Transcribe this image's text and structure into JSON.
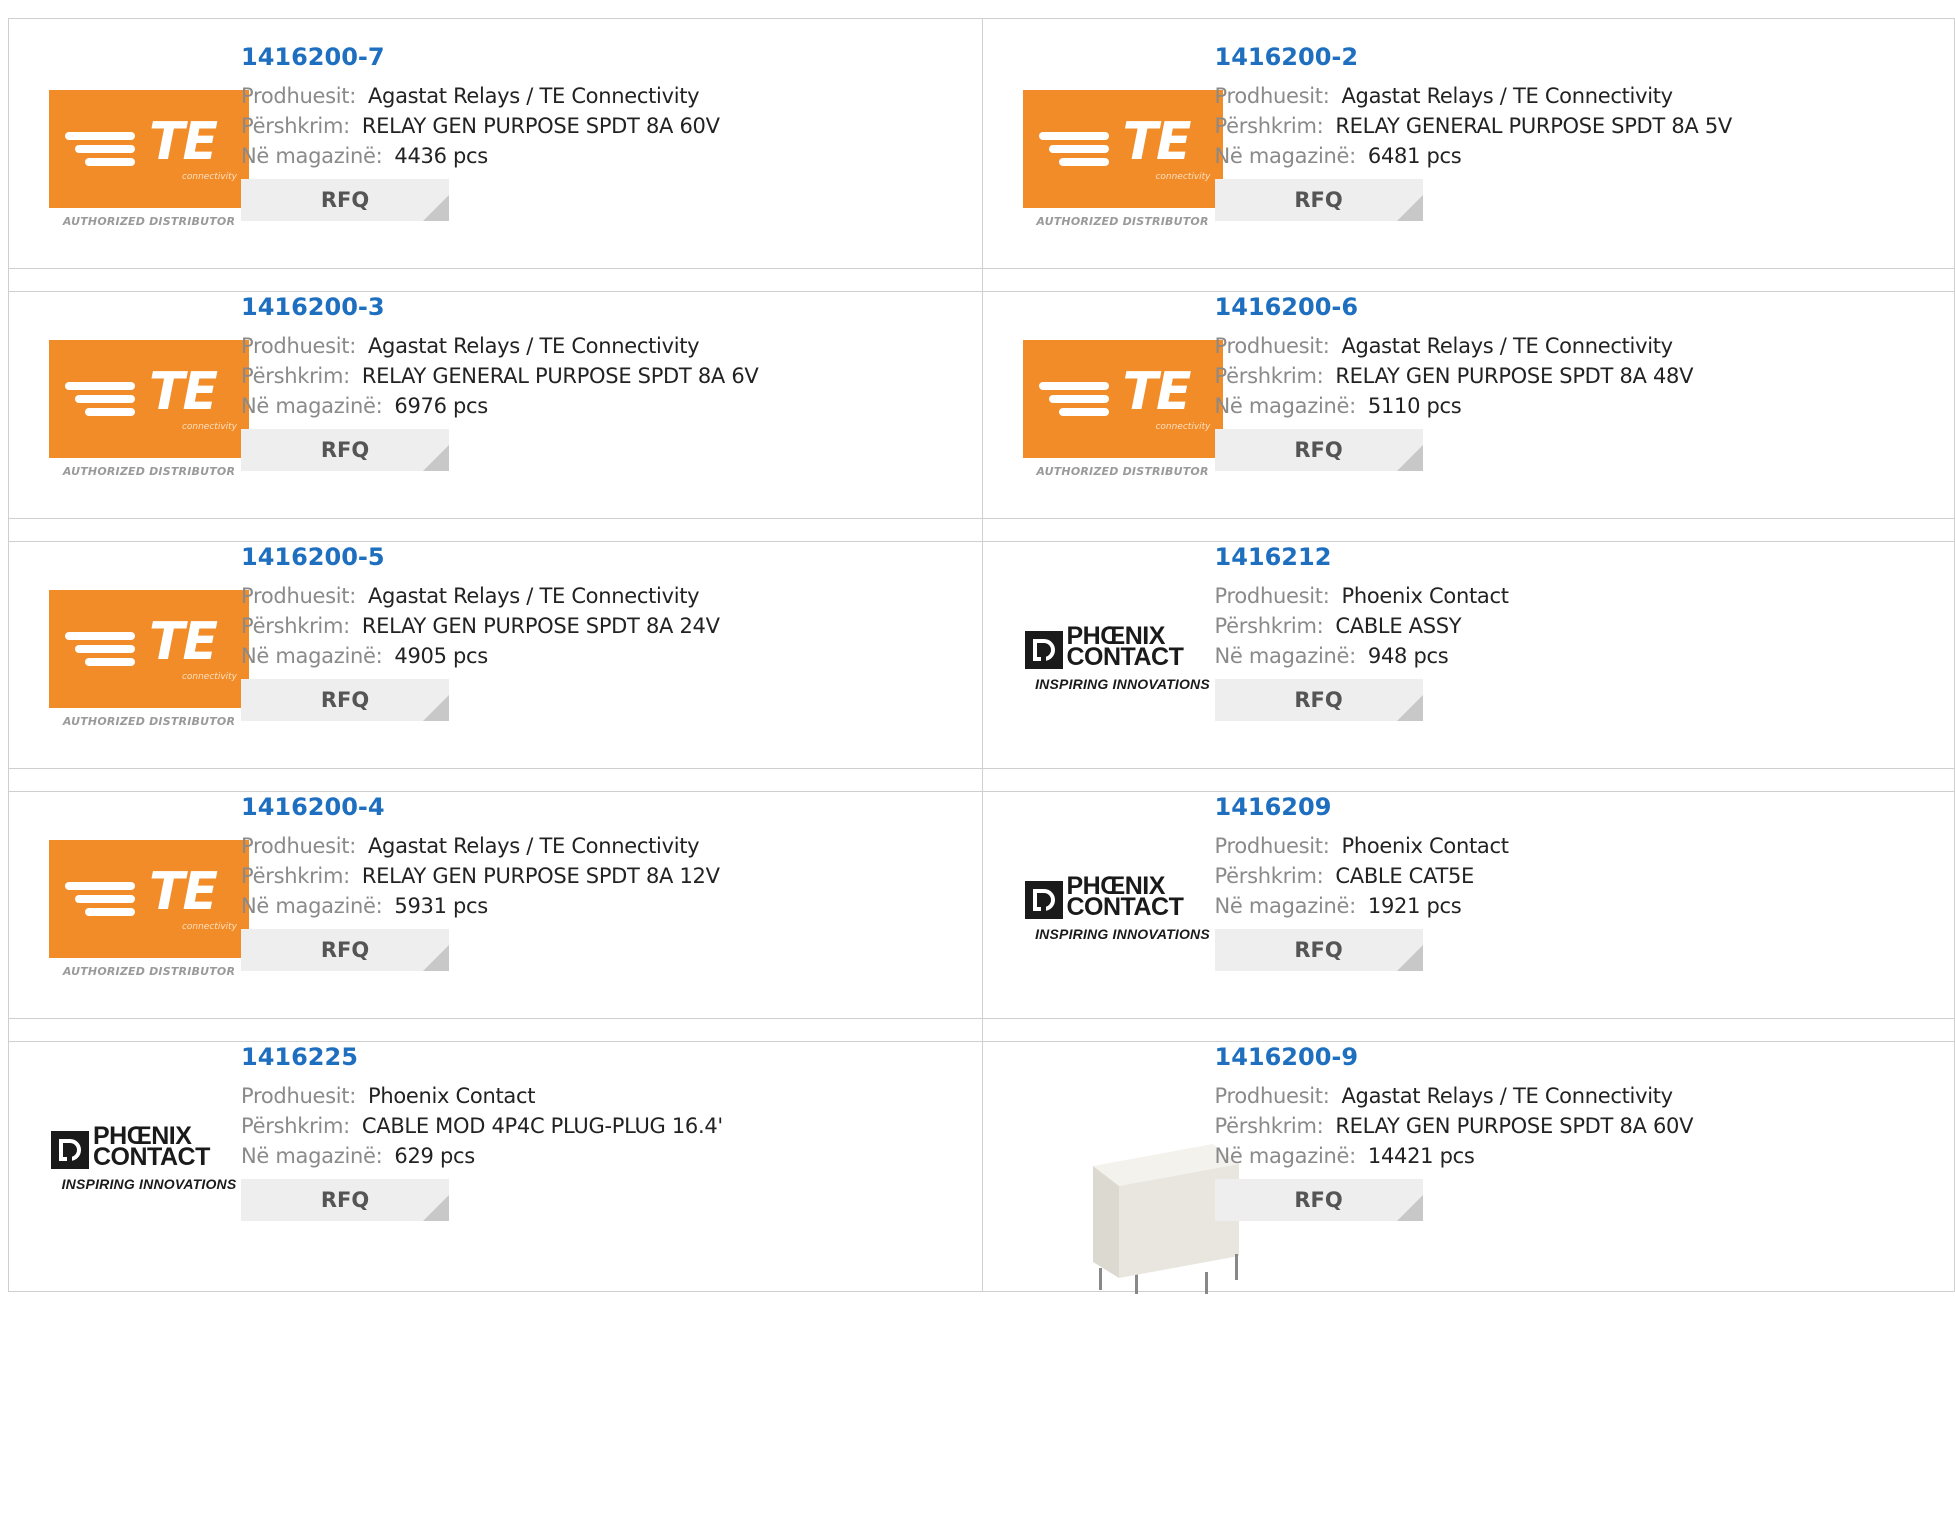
{
  "labels": {
    "manufacturer": "Prodhuesit:",
    "description": "Përshkrim:",
    "stock": "Në magazinë:",
    "rfq": "RFQ"
  },
  "brand_text": {
    "te": "TE",
    "te_sub": "connectivity",
    "te_authorized": "AUTHORIZED DISTRIBUTOR",
    "phoenix_name_1": "PHŒNIX",
    "phoenix_name_2": "CONTACT",
    "phoenix_tag": "INSPIRING INNOVATIONS"
  },
  "colors": {
    "part_link": "#1e6fbf",
    "te_orange": "#f28c28",
    "border": "#cfcfcf",
    "rfq_bg": "#eeeeee"
  },
  "products": [
    {
      "part": "1416200-7",
      "manufacturer": "Agastat Relays / TE Connectivity",
      "description": "RELAY GEN PURPOSE SPDT 8A 60V",
      "stock": "4436 pcs",
      "logo": "te"
    },
    {
      "part": "1416200-2",
      "manufacturer": "Agastat Relays / TE Connectivity",
      "description": "RELAY GENERAL PURPOSE SPDT 8A 5V",
      "stock": "6481 pcs",
      "logo": "te"
    },
    {
      "part": "1416200-3",
      "manufacturer": "Agastat Relays / TE Connectivity",
      "description": "RELAY GENERAL PURPOSE SPDT 8A 6V",
      "stock": "6976 pcs",
      "logo": "te"
    },
    {
      "part": "1416200-6",
      "manufacturer": "Agastat Relays / TE Connectivity",
      "description": "RELAY GEN PURPOSE SPDT 8A 48V",
      "stock": "5110 pcs",
      "logo": "te"
    },
    {
      "part": "1416200-5",
      "manufacturer": "Agastat Relays / TE Connectivity",
      "description": "RELAY GEN PURPOSE SPDT 8A 24V",
      "stock": "4905 pcs",
      "logo": "te"
    },
    {
      "part": "1416212",
      "manufacturer": "Phoenix Contact",
      "description": "CABLE ASSY",
      "stock": "948 pcs",
      "logo": "phoenix"
    },
    {
      "part": "1416200-4",
      "manufacturer": "Agastat Relays / TE Connectivity",
      "description": "RELAY GEN PURPOSE SPDT 8A 12V",
      "stock": "5931 pcs",
      "logo": "te"
    },
    {
      "part": "1416209",
      "manufacturer": "Phoenix Contact",
      "description": "CABLE CAT5E",
      "stock": "1921 pcs",
      "logo": "phoenix"
    },
    {
      "part": "1416225",
      "manufacturer": "Phoenix Contact",
      "description": "CABLE MOD 4P4C PLUG-PLUG 16.4'",
      "stock": "629 pcs",
      "logo": "phoenix"
    },
    {
      "part": "1416200-9",
      "manufacturer": "Agastat Relays / TE Connectivity",
      "description": "RELAY GEN PURPOSE SPDT 8A 60V",
      "stock": "14421 pcs",
      "logo": "relay-photo"
    }
  ]
}
